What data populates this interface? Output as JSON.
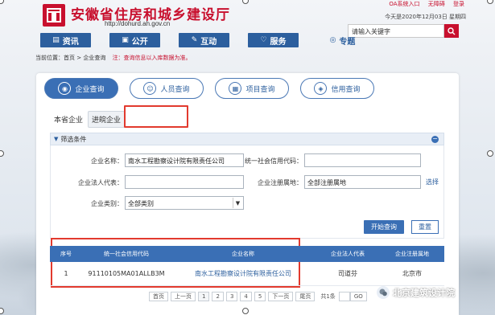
{
  "header": {
    "site_title": "安徽省住房和城乡建设厅",
    "site_url": "http://dohurd.ah.gov.cn",
    "top_links": [
      "OA系统入口",
      "无障碍",
      "登录"
    ],
    "date_text": "今天是2020年12月03日 星期四",
    "search_value": "请输入关键字"
  },
  "nav": {
    "items": [
      {
        "label": "资讯",
        "icon": "document-icon"
      },
      {
        "label": "公开",
        "icon": "folder-icon"
      },
      {
        "label": "互动",
        "icon": "chat-icon"
      },
      {
        "label": "服务",
        "icon": "heart-icon"
      },
      {
        "label": "专题",
        "icon": "bubble-icon"
      }
    ]
  },
  "breadcrumb": {
    "text": "当前位置：首页 > 企业查询",
    "note": "注：查询信息以入库数据为准。"
  },
  "tabs": [
    {
      "label": "企业查询",
      "active": true
    },
    {
      "label": "人员查询",
      "active": false
    },
    {
      "label": "项目查询",
      "active": false
    },
    {
      "label": "信用查询",
      "active": false
    }
  ],
  "subtabs": {
    "local": "本省企业",
    "entered": "进皖企业"
  },
  "filter": {
    "header": "筛选条件",
    "company_name_label": "企业名称：",
    "company_name_value": "南水工程勘察设计院有限责任公司",
    "credit_code_label": "统一社会信用代码：",
    "credit_code_value": "",
    "legal_rep_label": "企业法人代表：",
    "legal_rep_value": "",
    "reg_place_label": "企业注册属地：",
    "reg_place_value": "全部注册属地",
    "reg_place_link": "选择",
    "category_label": "企业类别：",
    "category_value": "全部类别",
    "search_button": "开始查询",
    "reset_button": "重置"
  },
  "table": {
    "headers": [
      "序号",
      "统一社会信用代码",
      "企业名称",
      "企业法人代表",
      "企业注册属地"
    ],
    "rows": [
      [
        "1",
        "91110105MA01ALLB3M",
        "南水工程勘察设计院有限责任公司",
        "司道芬",
        "北京市"
      ]
    ]
  },
  "pager": {
    "first": "首页",
    "prev": "上一页",
    "pages": [
      "1",
      "2",
      "3",
      "4",
      "5"
    ],
    "next": "下一页",
    "last": "尾页",
    "total": "共1条",
    "go": "GO"
  },
  "watermark": {
    "text": "北京建筑设计院"
  },
  "colors": {
    "brand_red": "#c8102e",
    "brand_blue": "#2c5f9e",
    "highlight_red": "#e23a2e"
  }
}
